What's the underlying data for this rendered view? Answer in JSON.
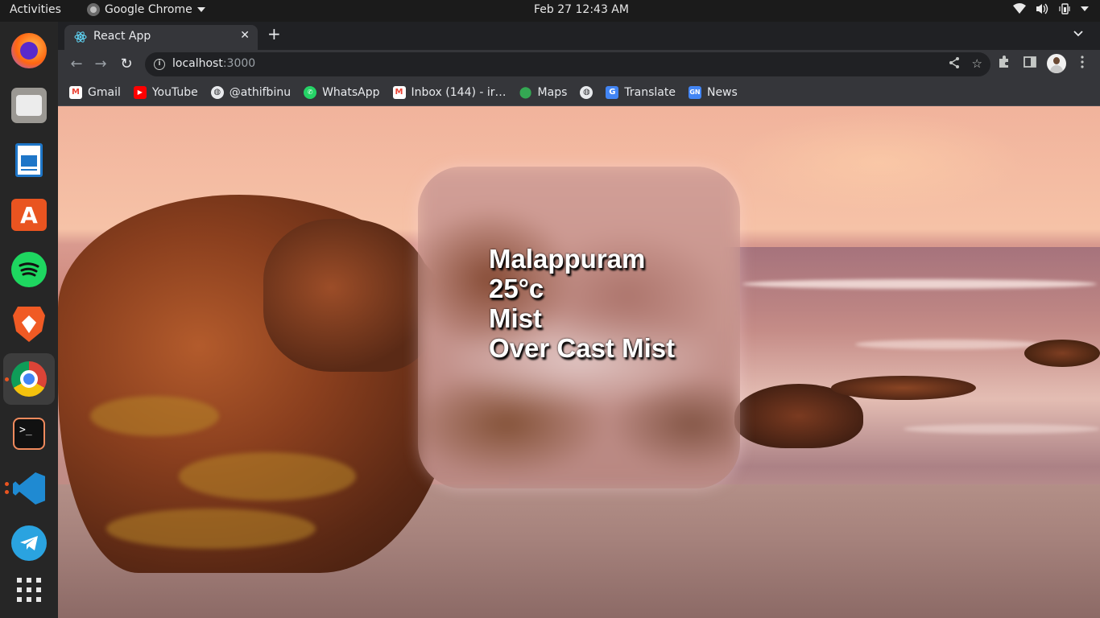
{
  "topbar": {
    "activities": "Activities",
    "app_name": "Google Chrome",
    "clock": "Feb 27  12:43 AM"
  },
  "dock": {
    "items": [
      "firefox-icon",
      "files-icon",
      "writer-icon",
      "software-icon",
      "spotify-icon",
      "brave-icon",
      "chrome-icon",
      "terminal-icon",
      "vscode-icon",
      "telegram-icon",
      "apps-grid-icon"
    ],
    "active": "chrome-icon"
  },
  "browser": {
    "tab_title": "React App",
    "url_host": "localhost",
    "url_port": ":3000",
    "bookmarks": [
      {
        "label": "Gmail",
        "icon": "gmail-icon",
        "color": "#ea4335"
      },
      {
        "label": "YouTube",
        "icon": "youtube-icon",
        "color": "#ff0000"
      },
      {
        "label": "@athifbinu",
        "icon": "globe-icon",
        "color": "#e8eaed"
      },
      {
        "label": "WhatsApp",
        "icon": "whatsapp-icon",
        "color": "#25d366"
      },
      {
        "label": "Inbox (144) - ir…",
        "icon": "gmail-icon",
        "color": "#ea4335"
      },
      {
        "label": "Maps",
        "icon": "maps-icon",
        "color": "#34a853"
      },
      {
        "label": "",
        "icon": "globe-icon",
        "color": "#e8eaed"
      },
      {
        "label": "Translate",
        "icon": "translate-icon",
        "color": "#4285f4"
      },
      {
        "label": "News",
        "icon": "news-icon",
        "color": "#4285f4"
      }
    ]
  },
  "weather": {
    "city": "Malappuram",
    "temperature": "25°c",
    "condition": "Mist",
    "description": "Over Cast Mist"
  },
  "colors": {
    "accent_orange": "#e95420",
    "chrome_dark": "#202124",
    "chrome_toolbar": "#35363a"
  }
}
